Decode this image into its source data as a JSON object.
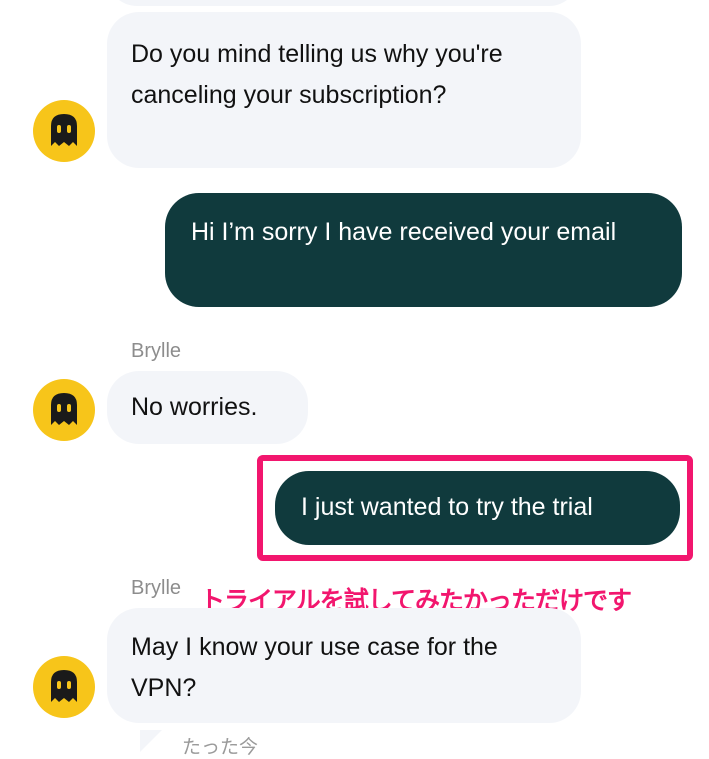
{
  "messages": [
    {
      "from": "agent",
      "text": "Do you mind telling us why you're canceling your subscription?"
    },
    {
      "from": "user",
      "text": "Hi I’m sorry I have received your email"
    },
    {
      "from": "agent",
      "sender": "Brylle",
      "text": "No worries."
    },
    {
      "from": "user",
      "text": "I just wanted to try the trial"
    },
    {
      "from": "agent",
      "sender": "Brylle",
      "text": "May I know your use case for the VPN?"
    }
  ],
  "annotation": {
    "text": "トライアルを試してみたかっただけです",
    "color": "#f2166e"
  },
  "timestamp": "たった今",
  "colors": {
    "agent_bubble": "#f3f5f9",
    "user_bubble": "#103a3d",
    "avatar": "#f7c51a"
  },
  "icons": {
    "avatar": "ghost-icon"
  }
}
